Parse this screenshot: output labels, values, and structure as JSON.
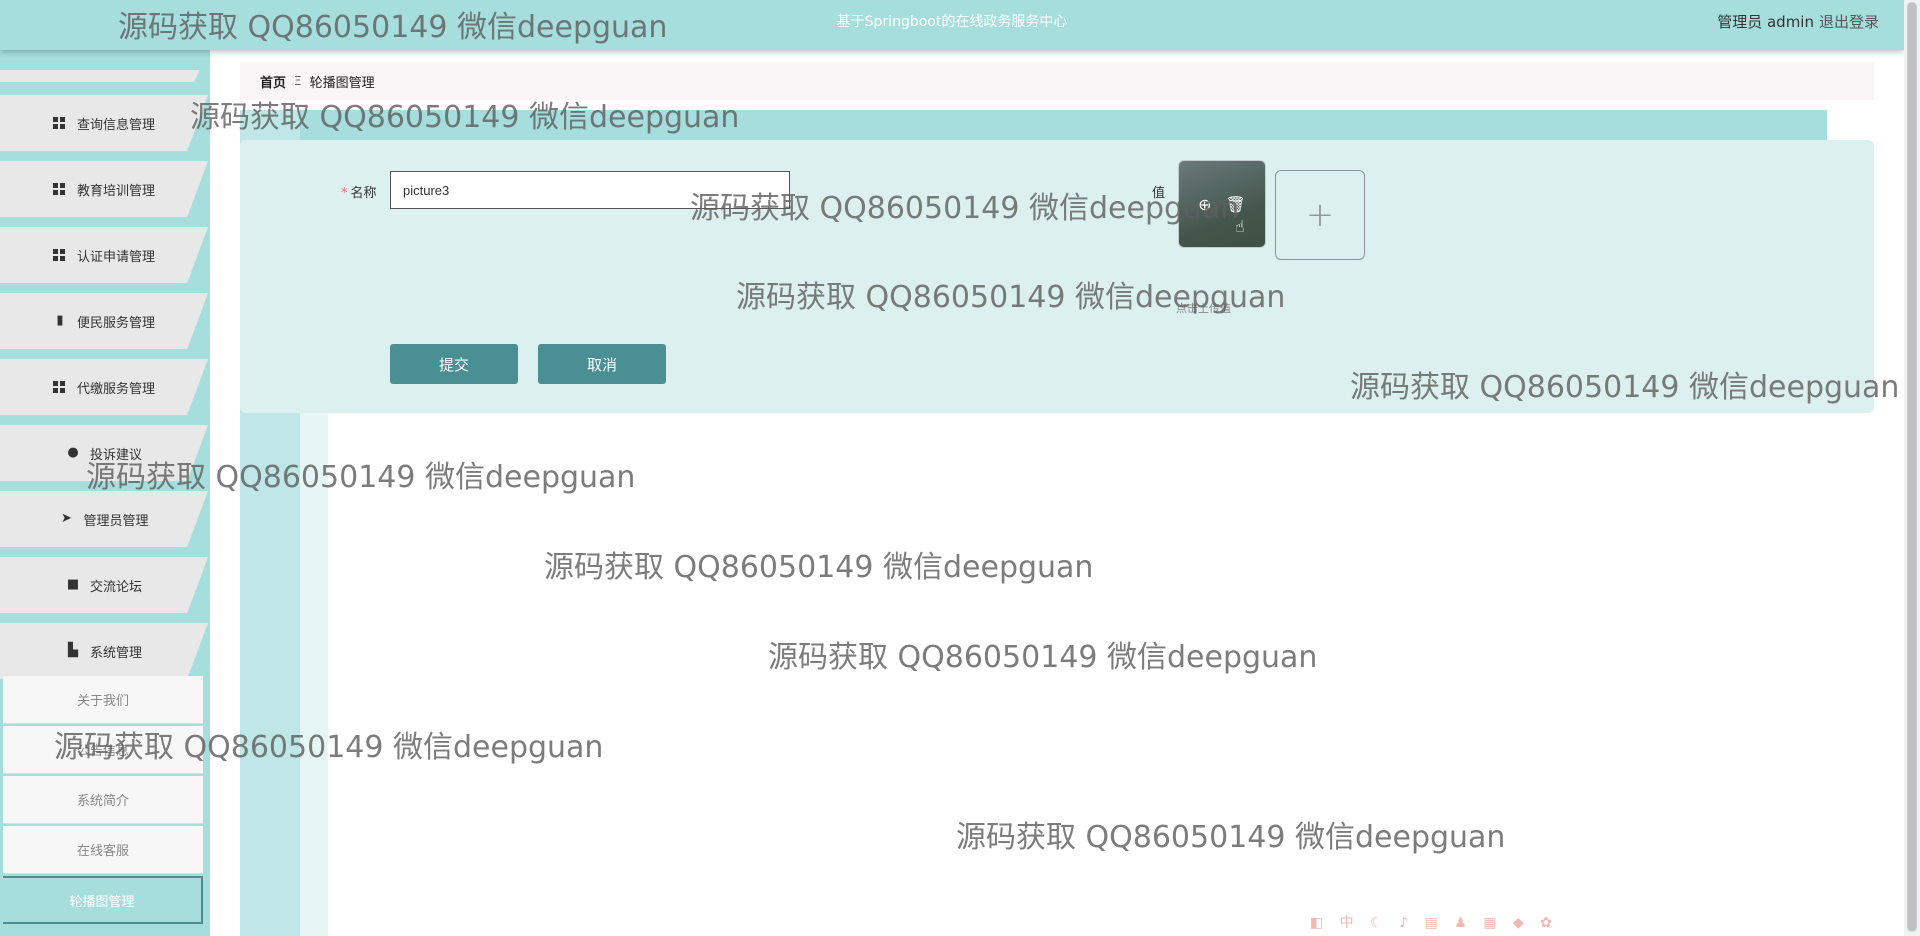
{
  "header": {
    "title": "基于Springboot的在线政务服务中心",
    "user": "管理员 admin",
    "logout": "退出登录"
  },
  "sidebar": {
    "items": [
      {
        "label": "查询信息管理",
        "icon": "grid-icon"
      },
      {
        "label": "教育培训管理",
        "icon": "grid-icon"
      },
      {
        "label": "认证申请管理",
        "icon": "grid-icon"
      },
      {
        "label": "便民服务管理",
        "icon": "bar-chart-icon"
      },
      {
        "label": "代缴服务管理",
        "icon": "grid-icon"
      },
      {
        "label": "投诉建议",
        "icon": "user-icon"
      },
      {
        "label": "管理员管理",
        "icon": "paper-plane-icon"
      },
      {
        "label": "交流论坛",
        "icon": "clipboard-check-icon"
      },
      {
        "label": "系统管理",
        "icon": "book-icon"
      }
    ],
    "sub_items": [
      {
        "label": "关于我们"
      },
      {
        "label": "公告信息"
      },
      {
        "label": "系统简介"
      },
      {
        "label": "在线客服"
      },
      {
        "label": "轮播图管理"
      }
    ]
  },
  "breadcrumb": {
    "home": "首页",
    "separator": "Ξ",
    "current": "轮播图管理"
  },
  "form": {
    "name_label": "名称",
    "name_required": "*",
    "name_value": "picture3",
    "value_label": "值",
    "upload_plus": "+",
    "upload_hint": "点击上传值",
    "submit_label": "提交",
    "cancel_label": "取消"
  },
  "watermark": "源码获取 QQ86050149 微信deepguan",
  "colors": {
    "accent": "#a6dedd",
    "button": "#4a8f93",
    "panel": "#dcf0ef"
  }
}
